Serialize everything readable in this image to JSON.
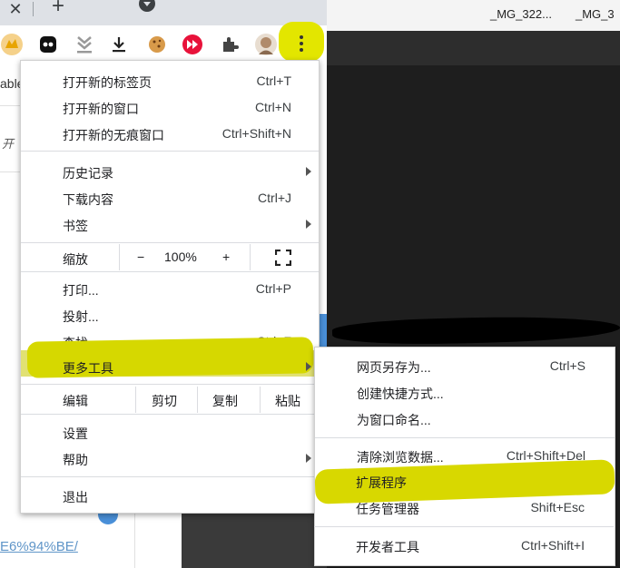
{
  "browser": {
    "tab_close": "✕",
    "new_tab": "+",
    "file_labels": [
      "_MG_322...",
      "_MG_3"
    ],
    "background_left_text": "able",
    "background_card_text": "开",
    "background_link": "E6%94%BE/"
  },
  "toolbar": {
    "icons": [
      "cat-extension-icon",
      "panda-extension-icon",
      "download-arrows-extension-icon",
      "download-icon",
      "cookie-icon",
      "fast-forward-icon",
      "puzzle-extensions-icon",
      "avatar-icon",
      "more-menu-icon"
    ],
    "highlight_color": "#e3e600"
  },
  "menu": {
    "new_tab": {
      "label": "打开新的标签页",
      "shortcut": "Ctrl+T"
    },
    "new_window": {
      "label": "打开新的窗口",
      "shortcut": "Ctrl+N"
    },
    "new_incognito": {
      "label": "打开新的无痕窗口",
      "shortcut": "Ctrl+Shift+N"
    },
    "history": {
      "label": "历史记录"
    },
    "downloads": {
      "label": "下载内容",
      "shortcut": "Ctrl+J"
    },
    "bookmarks": {
      "label": "书签"
    },
    "zoom": {
      "label": "缩放",
      "minus": "−",
      "value": "100%",
      "plus": "+"
    },
    "print": {
      "label": "打印...",
      "shortcut": "Ctrl+P"
    },
    "cast": {
      "label": "投射..."
    },
    "find": {
      "label": "查找...",
      "shortcut": "Ctrl+F"
    },
    "more_tools": {
      "label": "更多工具"
    },
    "edit": {
      "label": "编辑",
      "cut": "剪切",
      "copy": "复制",
      "paste": "粘贴"
    },
    "settings": {
      "label": "设置"
    },
    "help": {
      "label": "帮助"
    },
    "exit": {
      "label": "退出"
    }
  },
  "submenu": {
    "save_page": {
      "label": "网页另存为...",
      "shortcut": "Ctrl+S"
    },
    "create_shortcut": {
      "label": "创建快捷方式..."
    },
    "name_window": {
      "label": "为窗口命名..."
    },
    "clear_data": {
      "label": "清除浏览数据...",
      "shortcut": "Ctrl+Shift+Del"
    },
    "extensions": {
      "label": "扩展程序"
    },
    "task_manager": {
      "label": "任务管理器",
      "shortcut": "Shift+Esc"
    },
    "dev_tools": {
      "label": "开发者工具",
      "shortcut": "Ctrl+Shift+I"
    }
  }
}
